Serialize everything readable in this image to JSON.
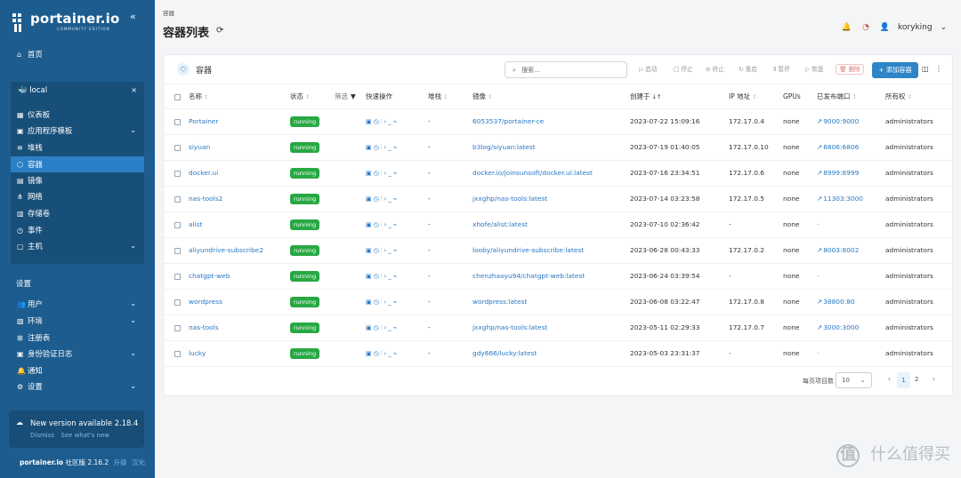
{
  "sidebar": {
    "logo_text": "portainer.io",
    "logo_subtitle": "COMMUNITY EDITION",
    "home": "首页",
    "environment": "local",
    "env_items": [
      {
        "label": "仪表板"
      },
      {
        "label": "应用程序模板"
      },
      {
        "label": "堆栈"
      },
      {
        "label": "容器"
      },
      {
        "label": "镜像"
      },
      {
        "label": "网络"
      },
      {
        "label": "存储卷"
      },
      {
        "label": "事件"
      },
      {
        "label": "主机"
      }
    ],
    "settings_title": "设置",
    "settings_items": [
      {
        "label": "用户"
      },
      {
        "label": "环境"
      },
      {
        "label": "注册表"
      },
      {
        "label": "身份验证日志"
      },
      {
        "label": "通知"
      },
      {
        "label": "设置"
      }
    ],
    "notice_title": "New version available 2.18.4",
    "notice_dismiss": "Dismiss",
    "notice_link": "See what's new",
    "footer_brand": "portainer.io",
    "footer_edition": "社区版 2.16.2",
    "footer_upgrade": "升级",
    "footer_localized": "汉化"
  },
  "header": {
    "breadcrumb": "容器",
    "title": "容器列表",
    "username": "koryking"
  },
  "card": {
    "title": "容器",
    "search_placeholder": "搜索...",
    "toolbar": {
      "start": "启动",
      "stop": "停止",
      "kill": "终止",
      "restart": "重启",
      "pause": "暂停",
      "resume": "恢复",
      "delete": "删除",
      "add": "添加容器"
    },
    "columns": {
      "name": "名称",
      "state": "状态",
      "filter": "筛选",
      "quick_actions": "快速操作",
      "stack": "堆栈",
      "image": "镜像",
      "created": "创建于",
      "ip": "IP 地址",
      "gpus": "GPUs",
      "ports": "已发布端口",
      "ownership": "所有权"
    },
    "rows": [
      {
        "name": "Portainer",
        "state": "running",
        "stack": "-",
        "image": "6053537/portainer-ce",
        "created": "2023-07-22 15:09:16",
        "ip": "172.17.0.4",
        "gpus": "none",
        "ports": "9000:9000",
        "ownership": "administrators"
      },
      {
        "name": "siyuan",
        "state": "running",
        "stack": "-",
        "image": "b3log/siyuan:latest",
        "created": "2023-07-19 01:40:05",
        "ip": "172.17.0.10",
        "gpus": "none",
        "ports": "6806:6806",
        "ownership": "administrators"
      },
      {
        "name": "docker.ui",
        "state": "running",
        "stack": "-",
        "image": "docker.io/joinsunsoft/docker.ui:latest",
        "created": "2023-07-16 23:34:51",
        "ip": "172.17.0.6",
        "gpus": "none",
        "ports": "8999:8999",
        "ownership": "administrators"
      },
      {
        "name": "nas-tools2",
        "state": "running",
        "stack": "-",
        "image": "jxxghp/nas-tools:latest",
        "created": "2023-07-14 03:23:58",
        "ip": "172.17.0.5",
        "gpus": "none",
        "ports": "11303:3000",
        "ownership": "administrators"
      },
      {
        "name": "alist",
        "state": "running",
        "stack": "-",
        "image": "xhofe/alist:latest",
        "created": "2023-07-10 02:36:42",
        "ip": "-",
        "gpus": "none",
        "ports": "-",
        "ownership": "administrators"
      },
      {
        "name": "aliyundrive-subscribe2",
        "state": "running",
        "stack": "-",
        "image": "looby/aliyundrive-subscribe:latest",
        "created": "2023-06-28 00:43:33",
        "ip": "172.17.0.2",
        "gpus": "none",
        "ports": "8003:8002",
        "ownership": "administrators"
      },
      {
        "name": "chatgpt-web",
        "state": "running",
        "stack": "-",
        "image": "chenzhaoyu94/chatgpt-web:latest",
        "created": "2023-06-24 03:39:54",
        "ip": "-",
        "gpus": "none",
        "ports": "-",
        "ownership": "administrators"
      },
      {
        "name": "wordpress",
        "state": "running",
        "stack": "-",
        "image": "wordpress:latest",
        "created": "2023-06-08 03:22:47",
        "ip": "172.17.0.8",
        "gpus": "none",
        "ports": "38800:80",
        "ownership": "administrators"
      },
      {
        "name": "nas-tools",
        "state": "running",
        "stack": "-",
        "image": "jxxghp/nas-tools:latest",
        "created": "2023-05-11 02:29:33",
        "ip": "172.17.0.7",
        "gpus": "none",
        "ports": "3000:3000",
        "ownership": "administrators"
      },
      {
        "name": "lucky",
        "state": "running",
        "stack": "-",
        "image": "gdy666/lucky:latest",
        "created": "2023-05-03 23:31:37",
        "ip": "-",
        "gpus": "none",
        "ports": "-",
        "ownership": "administrators"
      }
    ],
    "pagination": {
      "per_page_label": "每页项目数",
      "per_page_value": "10",
      "prev": "‹",
      "page_1": "1",
      "page_2": "2",
      "next": "›"
    }
  },
  "watermark": "什么值得买"
}
